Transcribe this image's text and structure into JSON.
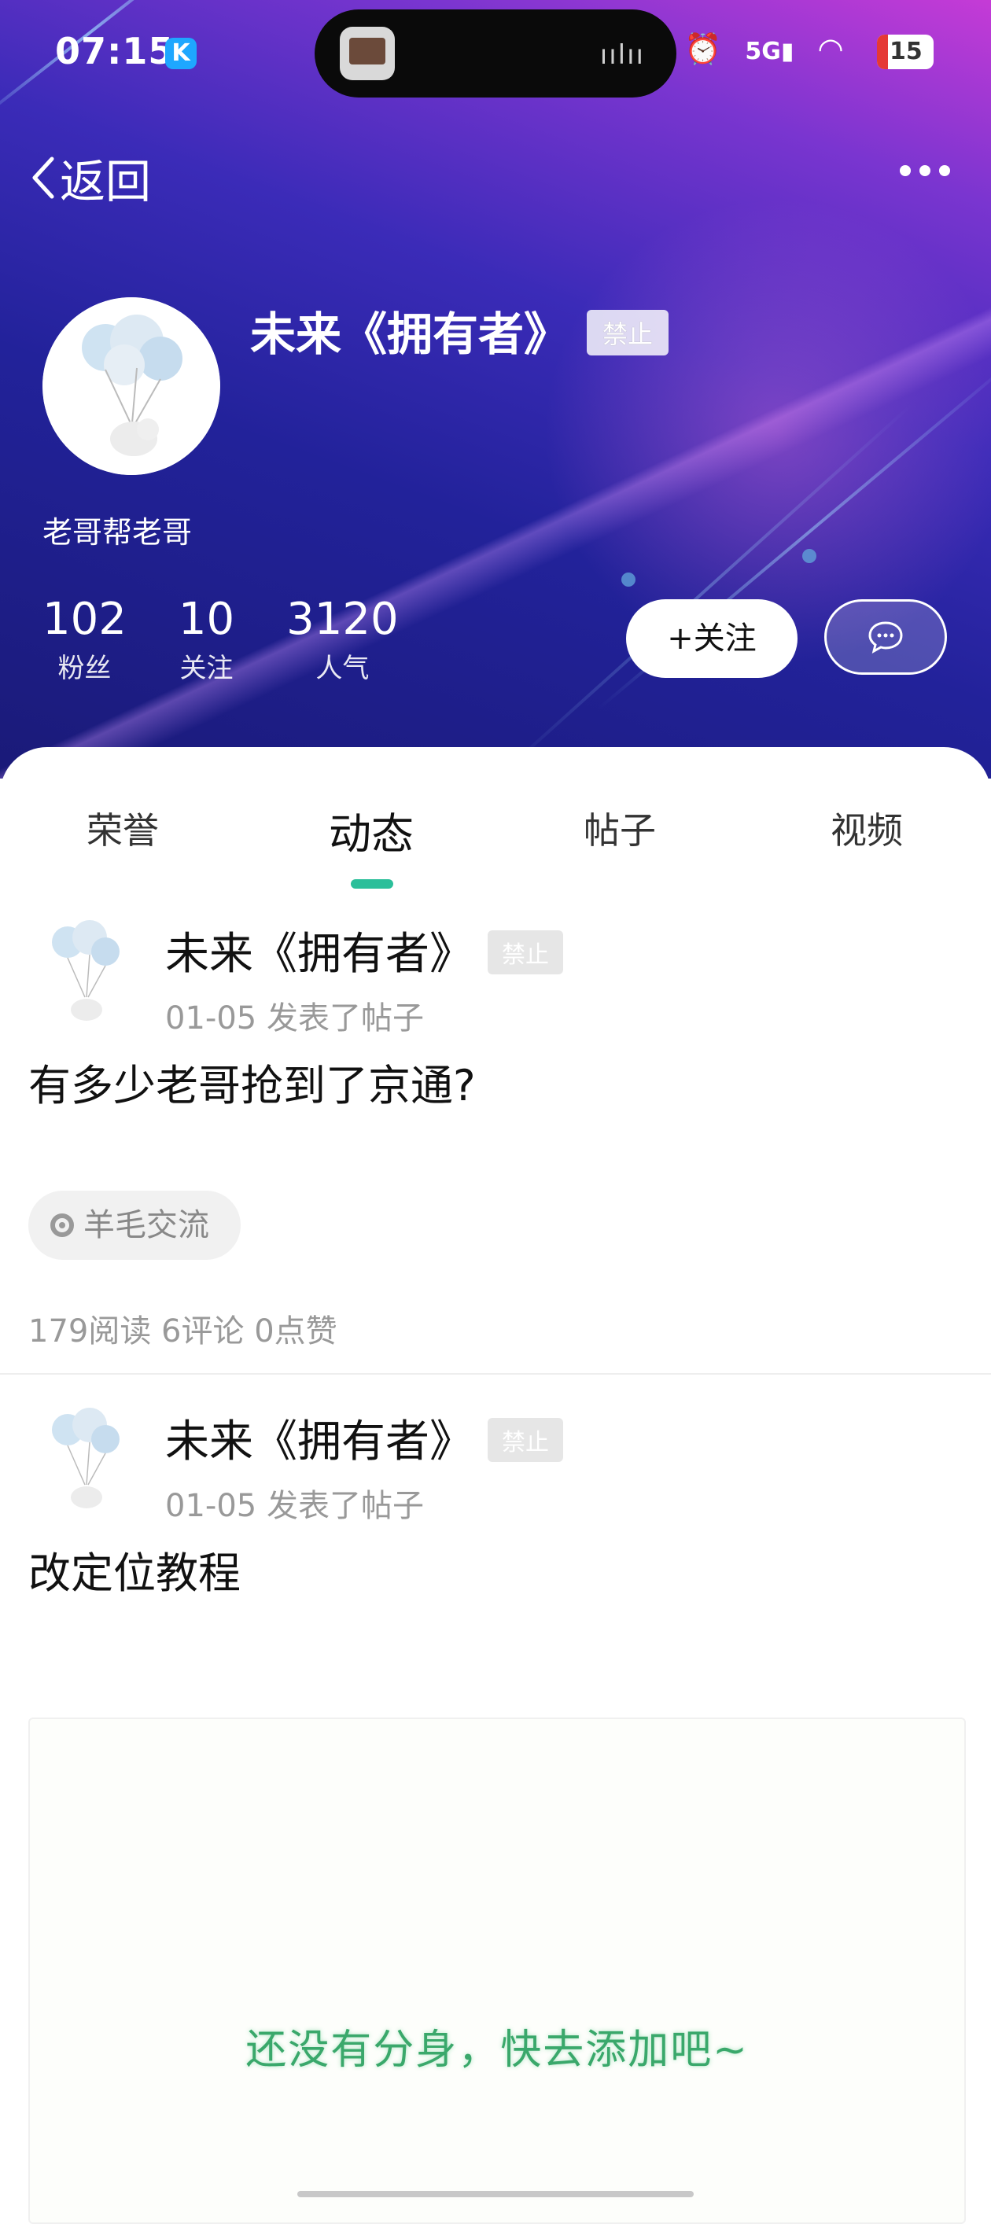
{
  "status_bar": {
    "time": "07:15",
    "app_badge": "K",
    "network": "5G",
    "battery": "15"
  },
  "nav": {
    "back_label": "返回"
  },
  "profile": {
    "nickname": "未来《拥有者》",
    "ban_badge": "禁止",
    "sub_name": "老哥帮老哥",
    "stats": [
      {
        "value": "102",
        "label": "粉丝"
      },
      {
        "value": "10",
        "label": "关注"
      },
      {
        "value": "3120",
        "label": "人气"
      }
    ],
    "follow_label": "+关注"
  },
  "tabs": [
    "荣誉",
    "动态",
    "帖子",
    "视频"
  ],
  "active_tab": "动态",
  "posts": [
    {
      "author": "未来《拥有者》",
      "ban_badge": "禁止",
      "meta": "01-05  发表了帖子",
      "title": "有多少老哥抢到了京通?",
      "topic": "羊毛交流",
      "stats": "179阅读 6评论 0点赞"
    },
    {
      "author": "未来《拥有者》",
      "ban_badge": "禁止",
      "meta": "01-05  发表了帖子",
      "title": "改定位教程",
      "preview_text": "还没有分身，快去添加吧~"
    }
  ],
  "colors": {
    "accent": "#2bbf9a",
    "preview_text": "#3aa86b"
  }
}
